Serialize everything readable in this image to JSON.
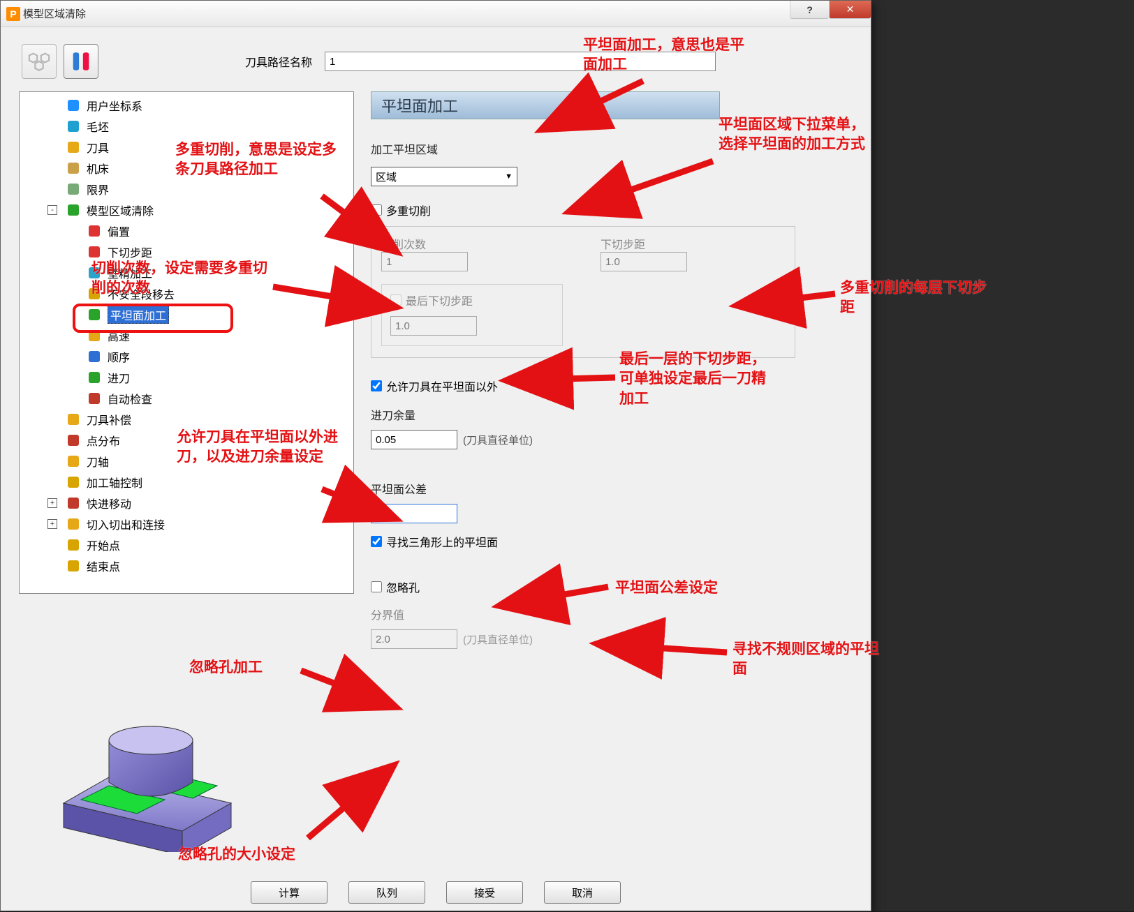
{
  "window": {
    "title": "模型区域清除"
  },
  "toolbar": {
    "name_label": "刀具路径名称",
    "name_value": "1"
  },
  "tree": [
    {
      "id": "ucs",
      "depth": 0,
      "label": "用户坐标系"
    },
    {
      "id": "blank",
      "depth": 0,
      "label": "毛坯"
    },
    {
      "id": "tool",
      "depth": 0,
      "label": "刀具"
    },
    {
      "id": "machine",
      "depth": 0,
      "label": "机床"
    },
    {
      "id": "limit",
      "depth": 0,
      "label": "限界"
    },
    {
      "id": "mrc",
      "depth": 0,
      "label": "模型区域清除",
      "exp": "-"
    },
    {
      "id": "offset",
      "depth": 1,
      "label": "偏置"
    },
    {
      "id": "stepdown",
      "depth": 1,
      "label": "下切步距"
    },
    {
      "id": "wallfin",
      "depth": 1,
      "label": "壁精加工"
    },
    {
      "id": "unsafe",
      "depth": 1,
      "label": "不安全段移去"
    },
    {
      "id": "flat",
      "depth": 1,
      "label": "平坦面加工",
      "selected": true
    },
    {
      "id": "hispeed",
      "depth": 1,
      "label": "高速"
    },
    {
      "id": "order",
      "depth": 1,
      "label": "顺序"
    },
    {
      "id": "leadin",
      "depth": 1,
      "label": "进刀"
    },
    {
      "id": "autochk",
      "depth": 1,
      "label": "自动检查"
    },
    {
      "id": "toolcomp",
      "depth": 0,
      "label": "刀具补偿"
    },
    {
      "id": "ptdist",
      "depth": 0,
      "label": "点分布"
    },
    {
      "id": "toolaxis",
      "depth": 0,
      "label": "刀轴"
    },
    {
      "id": "axisctl",
      "depth": 0,
      "label": "加工轴控制"
    },
    {
      "id": "rapid",
      "depth": 0,
      "label": "快进移动",
      "exp": "+"
    },
    {
      "id": "leads",
      "depth": 0,
      "label": "切入切出和连接",
      "exp": "+"
    },
    {
      "id": "startpt",
      "depth": 0,
      "label": "开始点"
    },
    {
      "id": "endpt",
      "depth": 0,
      "label": "结束点"
    }
  ],
  "form": {
    "section_title": "平坦面加工",
    "region_label": "加工平坦区域",
    "region_value": "区域",
    "multicut_label": "多重切削",
    "multicut_checked": false,
    "cutcount_label": "切削次数",
    "cutcount_value": "1",
    "stepdown_label": "下切步距",
    "stepdown_value": "1.0",
    "laststep_label": "最后下切步距",
    "laststep_checked": false,
    "laststep_value": "1.0",
    "allow_outside_label": "允许刀具在平坦面以外",
    "allow_outside_checked": true,
    "leadstock_label": "进刀余量",
    "leadstock_value": "0.05",
    "tdu_unit": "(刀具直径单位)",
    "flattol_label": "平坦面公差",
    "flattol_value": "1.0",
    "findflat_label": "寻找三角形上的平坦面",
    "findflat_checked": true,
    "ignorehole_label": "忽略孔",
    "ignorehole_checked": false,
    "threshold_label": "分界值",
    "threshold_value": "2.0"
  },
  "buttons": {
    "compute": "计算",
    "queue": "队列",
    "accept": "接受",
    "cancel": "取消"
  },
  "annots": {
    "a1": "平坦面加工，意思也是平面加工",
    "a2": "平坦面区域下拉菜单，选择平坦面的加工方式",
    "a3": "多重切削，意思是设定多条刀具路径加工",
    "a4": "切削次数，设定需要多重切削的次数",
    "a5": "多重切削的每层下切步距",
    "a6": "最后一层的下切步距，可单独设定最后一刀精加工",
    "a7": "允许刀具在平坦面以外进刀，以及进刀余量设定",
    "a8": "平坦面公差设定",
    "a9": "寻找不规则区域的平坦面",
    "a10": "忽略孔加工",
    "a11": "忽略孔的大小设定"
  }
}
